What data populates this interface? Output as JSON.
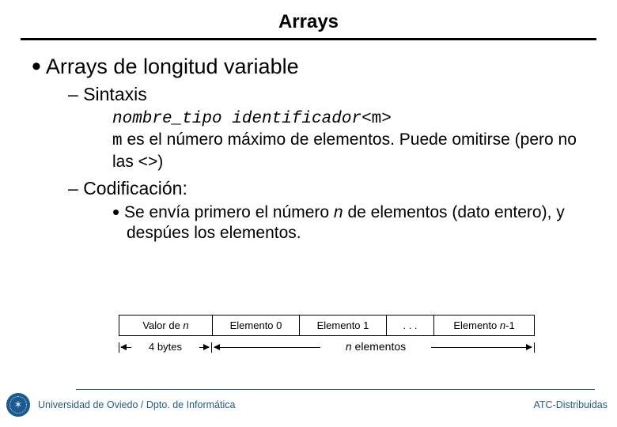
{
  "title": "Arrays",
  "bullet1": "Arrays de longitud variable",
  "syntax_heading": "Sintaxis",
  "syntax_code_prefix": "nombre_tipo identificador",
  "syntax_code_lt": "<",
  "syntax_code_m": "m",
  "syntax_code_gt": ">",
  "syntax_explain_m": "m",
  "syntax_explain_rest": " es el número máximo de elementos. Puede omitirse (pero no las <>)",
  "coding_heading": "Codificación:",
  "coding_point_a": "Se envía primero el número ",
  "coding_point_n": "n",
  "coding_point_b": " de elementos (dato entero), y despúes los elementos.",
  "diagram": {
    "cells": {
      "valor_pre": "Valor de ",
      "valor_n": "n",
      "e0": "Elemento 0",
      "e1": "Elemento 1",
      "dots": ". . .",
      "elast_pre": "Elemento ",
      "elast_n": "n",
      "elast_suf": "-1"
    },
    "label_4bytes": "4 bytes",
    "label_n_elems_n": "n",
    "label_n_elems_rest": " elementos"
  },
  "footer_left": "Universidad de Oviedo / Dpto. de Informática",
  "footer_right": "ATC-Distribuidas"
}
